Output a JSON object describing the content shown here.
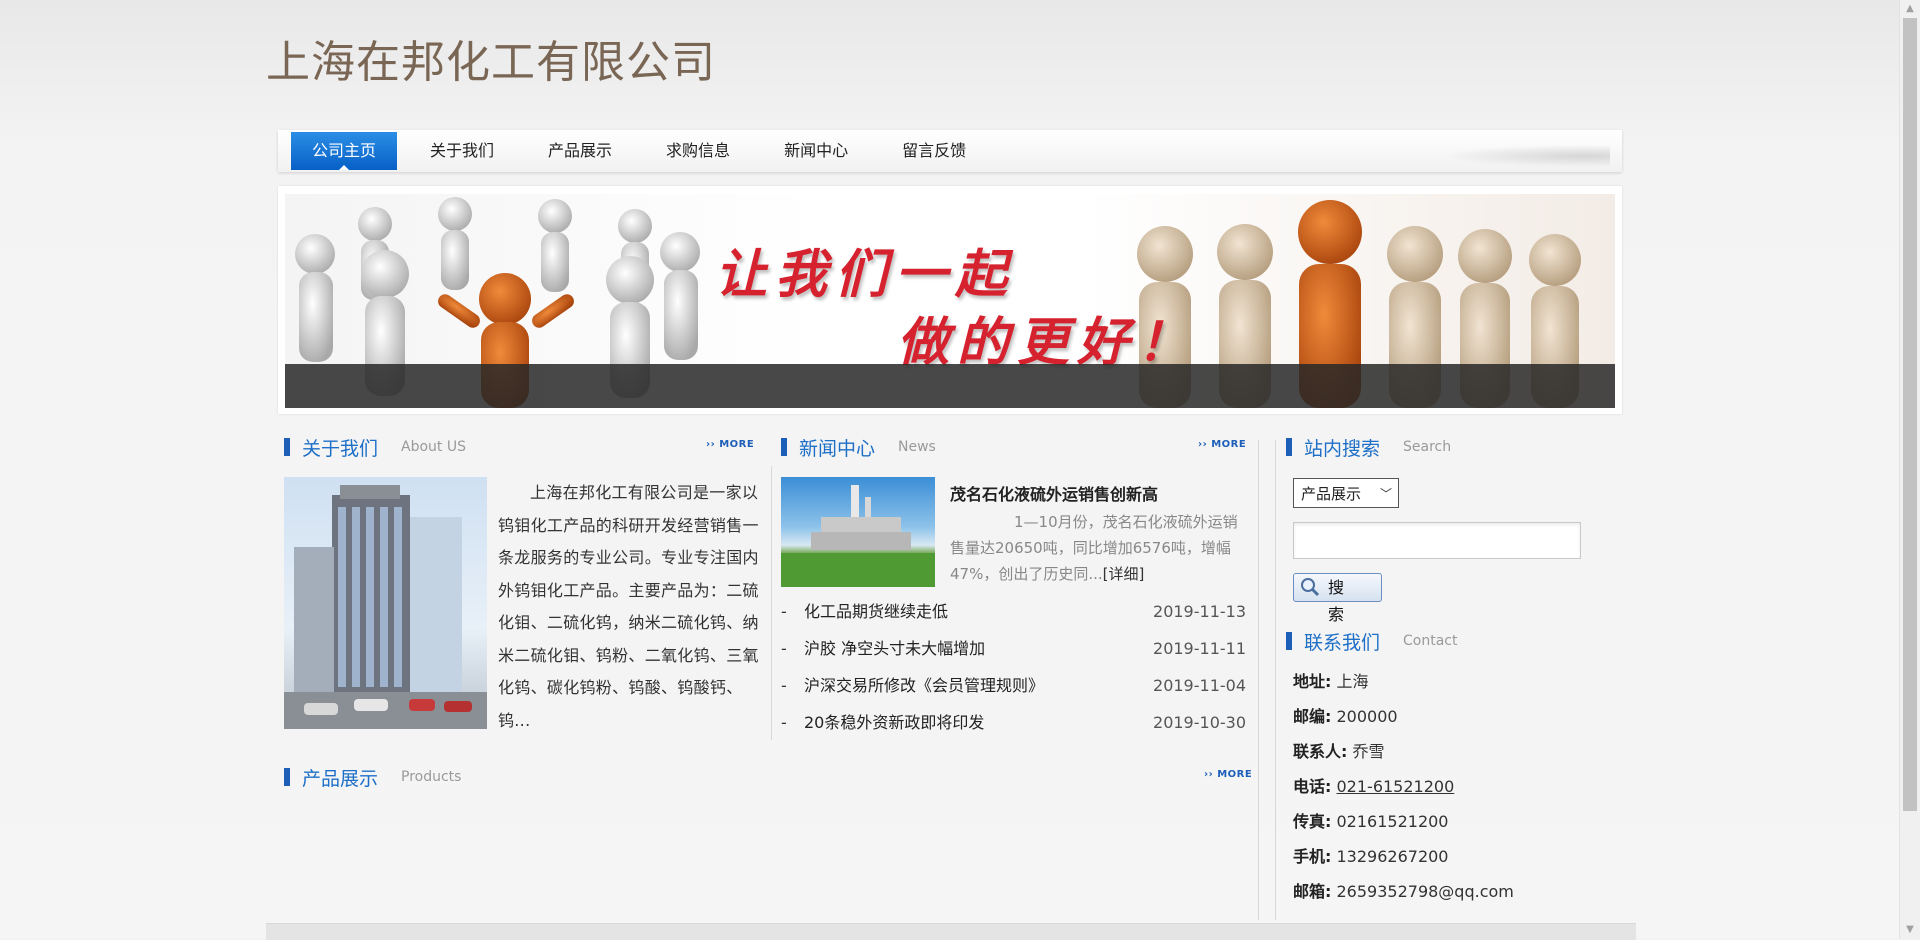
{
  "site": {
    "title": "上海在邦化工有限公司"
  },
  "nav": {
    "items": [
      "公司主页",
      "关于我们",
      "产品展示",
      "求购信息",
      "新闻中心",
      "留言反馈"
    ]
  },
  "banner": {
    "slogan_line1": "让我们一起",
    "slogan_line2": "做的更好！"
  },
  "about": {
    "title": "关于我们",
    "subtitle": "About US",
    "more": "›› MORE",
    "text": "上海在邦化工有限公司是一家以钨钼化工产品的科研开发经营销售一条龙服务的专业公司。专业专注国内外钨钼化工产品。主要产品为：二硫化钼、二硫化钨，纳米二硫化钨、纳米二硫化钼、钨粉、二氧化钨、三氧化钨、碳化钨粉、钨酸、钨酸钙、钨..."
  },
  "news": {
    "title": "新闻中心",
    "subtitle": "News",
    "more": "›› MORE",
    "headline": "茂名石化液硫外运销售创新高",
    "summary": "1—10月份，茂名石化液硫外运销售量达20650吨，同比增加6576吨，增幅47%，创出了历史同...",
    "detail_link": "[详细]",
    "items": [
      {
        "title": "化工品期货继续走低",
        "date": "2019-11-13"
      },
      {
        "title": "沪胶 净空头寸未大幅增加",
        "date": "2019-11-11"
      },
      {
        "title": "沪深交易所修改《会员管理规则》",
        "date": "2019-11-04"
      },
      {
        "title": "20条稳外资新政即将印发",
        "date": "2019-10-30"
      }
    ]
  },
  "products": {
    "title": "产品展示",
    "subtitle": "Products",
    "more": "›› MORE"
  },
  "search": {
    "title": "站内搜索",
    "subtitle": "Search",
    "select_value": "产品展示",
    "input_value": "",
    "button_label": "搜 索"
  },
  "contact": {
    "title": "联系我们",
    "subtitle": "Contact",
    "address_label": "地址:",
    "address": "上海",
    "zip_label": "邮编:",
    "zip": "200000",
    "person_label": "联系人:",
    "person": "乔雪",
    "phone_label": "电话:",
    "phone": "021-61521200",
    "fax_label": "传真:",
    "fax": "02161521200",
    "mobile_label": "手机:",
    "mobile": "13296267200",
    "email_label": "邮箱:",
    "email": "2659352798@qq.com"
  }
}
